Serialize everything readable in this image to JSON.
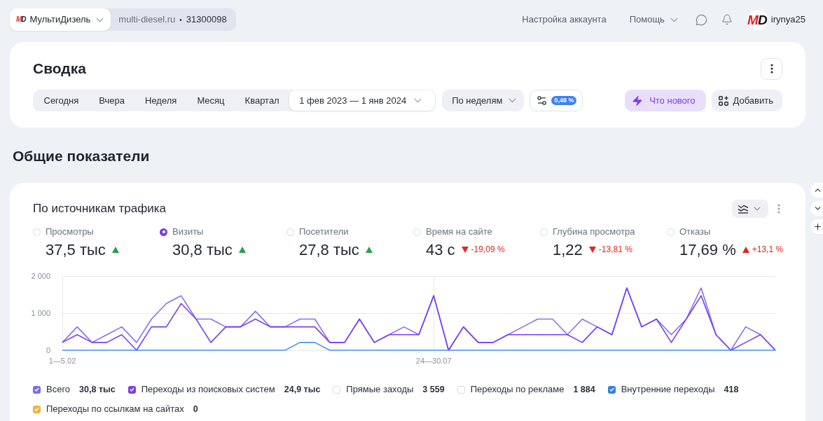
{
  "header": {
    "counter": {
      "logo": "MD",
      "name": "МультиДизель",
      "domain": "multi-diesel.ru",
      "separator": "•",
      "id": "31300098"
    },
    "links": [
      {
        "label": "Настройка аккаунта",
        "kind": "link"
      },
      {
        "label": "Помощь",
        "kind": "menu"
      }
    ],
    "user": {
      "logo": "MD",
      "name": "irynya25"
    }
  },
  "summary": {
    "title": "Сводка",
    "periods": [
      {
        "label": "Сегодня",
        "kind": "preset",
        "selected": false
      },
      {
        "label": "Вчера",
        "kind": "preset",
        "selected": false
      },
      {
        "label": "Неделя",
        "kind": "preset",
        "selected": false
      },
      {
        "label": "Месяц",
        "kind": "preset",
        "selected": false
      },
      {
        "label": "Квартал",
        "kind": "preset",
        "selected": false
      },
      {
        "label": "1 фев 2023 — 1 янв 2024",
        "kind": "range",
        "selected": true
      }
    ],
    "grouping": "По неделям",
    "filter_badge": "0,48 %",
    "buttons": [
      {
        "label": "Что нового",
        "kind": "accent"
      },
      {
        "label": "Добавить",
        "kind": "plain"
      }
    ]
  },
  "section_title": "Общие показатели",
  "traffic": {
    "title": "По источникам трафика",
    "metrics": [
      {
        "label": "Просмотры",
        "value": "37,5 тыс",
        "trend_up": true,
        "good": true,
        "selected": false
      },
      {
        "label": "Визиты",
        "value": "30,8 тыс",
        "trend_up": true,
        "good": true,
        "selected": true
      },
      {
        "label": "Посетители",
        "value": "27,8 тыс",
        "trend_up": true,
        "good": true,
        "selected": false
      },
      {
        "label": "Время на сайте",
        "value": "43 с",
        "trend_up": false,
        "good": false,
        "change": "-19,09 %",
        "selected": false
      },
      {
        "label": "Глубина просмотра",
        "value": "1,22",
        "trend_up": false,
        "good": false,
        "change": "-13,81 %",
        "selected": false
      },
      {
        "label": "Отказы",
        "value": "17,69 %",
        "trend_up": true,
        "good": false,
        "change": "+13,1 %",
        "selected": false
      }
    ],
    "chart_data": {
      "type": "line",
      "categories": [
        "1—5.02",
        null,
        null,
        null,
        null,
        null,
        null,
        null,
        null,
        null,
        null,
        null,
        null,
        null,
        null,
        null,
        null,
        null,
        null,
        null,
        null,
        null,
        null,
        null,
        null,
        "24—30.07",
        null,
        null,
        null,
        null,
        null,
        null,
        null,
        null,
        null,
        null,
        null,
        null,
        null,
        null,
        null,
        null,
        null,
        null,
        null,
        null,
        null,
        null,
        null
      ],
      "ylim": [
        0,
        2000
      ],
      "yticks": [
        {
          "value": 0,
          "label": "0"
        },
        {
          "value": 1000,
          "label": "1 000"
        },
        {
          "value": 2000,
          "label": "2 000"
        }
      ],
      "series": [
        {
          "color": "#8a6ff2",
          "values": [
            210,
            630,
            210,
            420,
            630,
            210,
            840,
            1260,
            1470,
            840,
            840,
            630,
            630,
            1050,
            630,
            630,
            840,
            840,
            210,
            210,
            840,
            210,
            420,
            630,
            420,
            1470,
            0,
            630,
            210,
            210,
            420,
            630,
            840,
            840,
            420,
            840,
            630,
            420,
            1680,
            630,
            840,
            420,
            840,
            1680,
            420,
            0,
            630,
            420,
            0
          ]
        },
        {
          "color": "#7a3ff0",
          "values": [
            210,
            420,
            210,
            210,
            420,
            0,
            630,
            630,
            1260,
            840,
            210,
            630,
            630,
            840,
            630,
            630,
            630,
            630,
            210,
            210,
            840,
            210,
            420,
            420,
            420,
            1470,
            0,
            630,
            210,
            210,
            420,
            420,
            420,
            420,
            420,
            210,
            630,
            420,
            1680,
            630,
            840,
            210,
            840,
            1470,
            420,
            0,
            210,
            420,
            0
          ]
        },
        {
          "color": "#4a93f2",
          "values": [
            0,
            0,
            0,
            0,
            0,
            0,
            0,
            0,
            0,
            0,
            0,
            0,
            0,
            0,
            0,
            0,
            210,
            210,
            0,
            0,
            0,
            0,
            0,
            0,
            0,
            0,
            0,
            0,
            0,
            0,
            0,
            0,
            0,
            0,
            0,
            0,
            0,
            0,
            0,
            0,
            0,
            0,
            0,
            0,
            0,
            0,
            0,
            0,
            0
          ]
        }
      ]
    },
    "legend": [
      {
        "label": "Всего",
        "value": "30,8 тыс",
        "checked": true,
        "color": "#7b6cec"
      },
      {
        "label": "Переходы из поисковых систем",
        "value": "24,9 тыс",
        "checked": true,
        "color": "#7b3fe4"
      },
      {
        "label": "Прямые заходы",
        "value": "3 559",
        "checked": false
      },
      {
        "label": "Переходы по рекламе",
        "value": "1 884",
        "checked": false
      },
      {
        "label": "Внутренние переходы",
        "value": "418",
        "checked": true,
        "color": "#2f80ed"
      },
      {
        "label": "Переходы по ссылкам на сайтах",
        "value": "0",
        "checked": true,
        "color": "#f5b041"
      }
    ]
  }
}
